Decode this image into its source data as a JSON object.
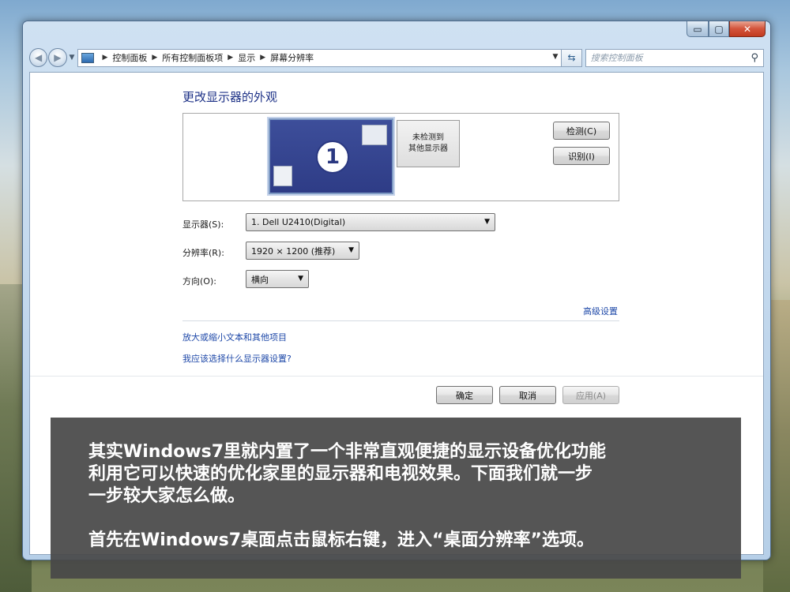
{
  "window": {
    "caption": {
      "minimize": "▭",
      "maximize": "▢",
      "close": "✕"
    }
  },
  "address_bar": {
    "breadcrumbs": [
      "控制面板",
      "所有控制面板项",
      "显示",
      "屏幕分辨率"
    ],
    "search_placeholder": "搜索控制面板"
  },
  "main": {
    "title": "更改显示器的外观",
    "monitor_primary_label": "1",
    "monitor_secondary": {
      "line1": "未检测到",
      "line2": "其他显示器"
    },
    "detect_button": "检测(C)",
    "identify_button": "识别(I)",
    "display_label": "显示器(S):",
    "display_value": "1. Dell U2410(Digital)",
    "resolution_label": "分辨率(R):",
    "resolution_value": "1920 × 1200 (推荐)",
    "orientation_label": "方向(O):",
    "orientation_value": "横向",
    "advanced_link": "高级设置",
    "link_text_size": "放大或缩小文本和其他项目",
    "link_which_settings": "我应该选择什么显示器设置?",
    "ok_button": "确定",
    "cancel_button": "取消",
    "apply_button": "应用(A)"
  },
  "overlay": {
    "line1": "其实Windows7里就内置了一个非常直观便捷的显示设备优化功能",
    "line2": "利用它可以快速的优化家里的显示器和电视效果。下面我们就一步",
    "line3": "一步较大家怎么做。",
    "line4": "首先在Windows7桌面点击鼠标右键，进入“桌面分辨率”选项。"
  },
  "colors": {
    "accent_title": "#1e3287",
    "link": "#1e48a8",
    "monitor_fill": "#2e3c86",
    "overlay_bg": "#484848",
    "close_button": "#c23b20"
  }
}
